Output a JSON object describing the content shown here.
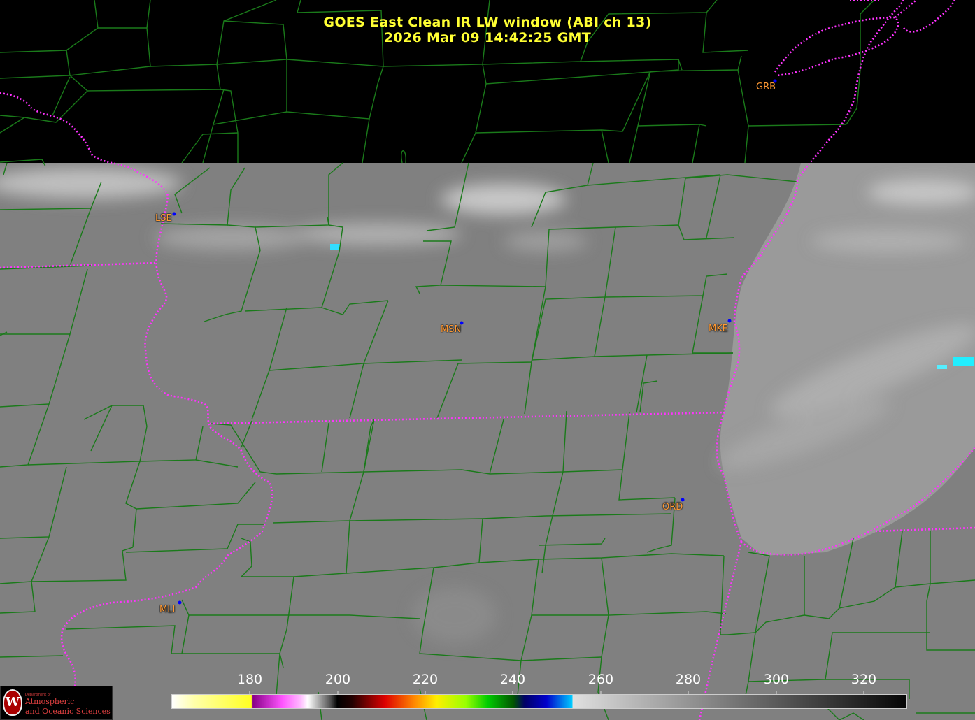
{
  "title": {
    "line1": "GOES East Clean IR LW window (ABI ch 13)",
    "line2": "2026 Mar 09  14:42:25 GMT"
  },
  "stations": [
    {
      "id": "GRB"
    },
    {
      "id": "LSE"
    },
    {
      "id": "MSN"
    },
    {
      "id": "MKE"
    },
    {
      "id": "ORD"
    },
    {
      "id": "MLI"
    }
  ],
  "colorbar": {
    "ticks": [
      "180",
      "200",
      "220",
      "240",
      "260",
      "280",
      "300",
      "320"
    ]
  },
  "colors": {
    "title": "#ffff33",
    "station_label": "#ff9933",
    "station_dot": "#0000ff",
    "county_border": "#1a7a1a",
    "state_border": "#ff33ff",
    "background": "#000000"
  },
  "logo": {
    "dept": "Department of",
    "line1": "Atmospheric",
    "line2": "and Oceanic Sciences"
  }
}
